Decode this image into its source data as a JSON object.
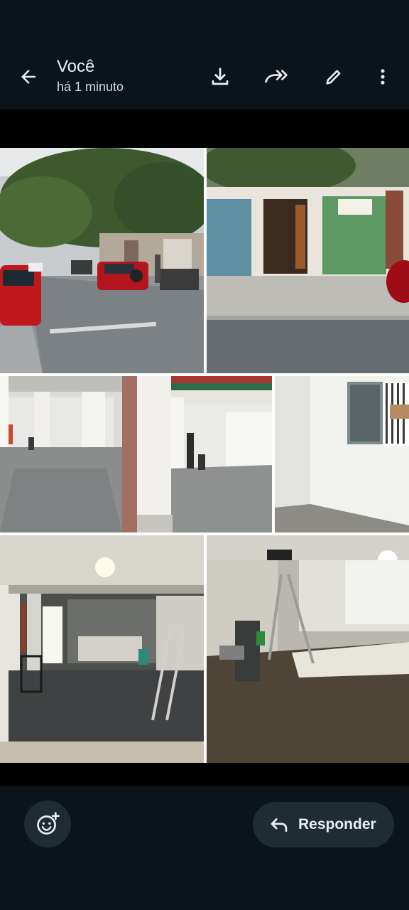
{
  "header": {
    "title": "Você",
    "subtitle": "há 1 minuto",
    "icons": [
      "back-arrow-icon",
      "download-icon",
      "forward-icon",
      "pencil-icon",
      "more-vertical-icon"
    ]
  },
  "photo": {
    "kind": "collage",
    "tiles": [
      "street-with-red-cars",
      "storefronts-green-door",
      "interior-columns-left",
      "interior-columns-right",
      "room-with-window",
      "basement-with-ladder",
      "hall-with-ladder"
    ]
  },
  "footer": {
    "reply_label": "Responder",
    "icons": [
      "emoji-add-icon",
      "reply-arrow-icon"
    ]
  },
  "colors": {
    "bar_bg": "#0b141a",
    "button_bg": "#1f2c34",
    "text": "#e9edef"
  }
}
